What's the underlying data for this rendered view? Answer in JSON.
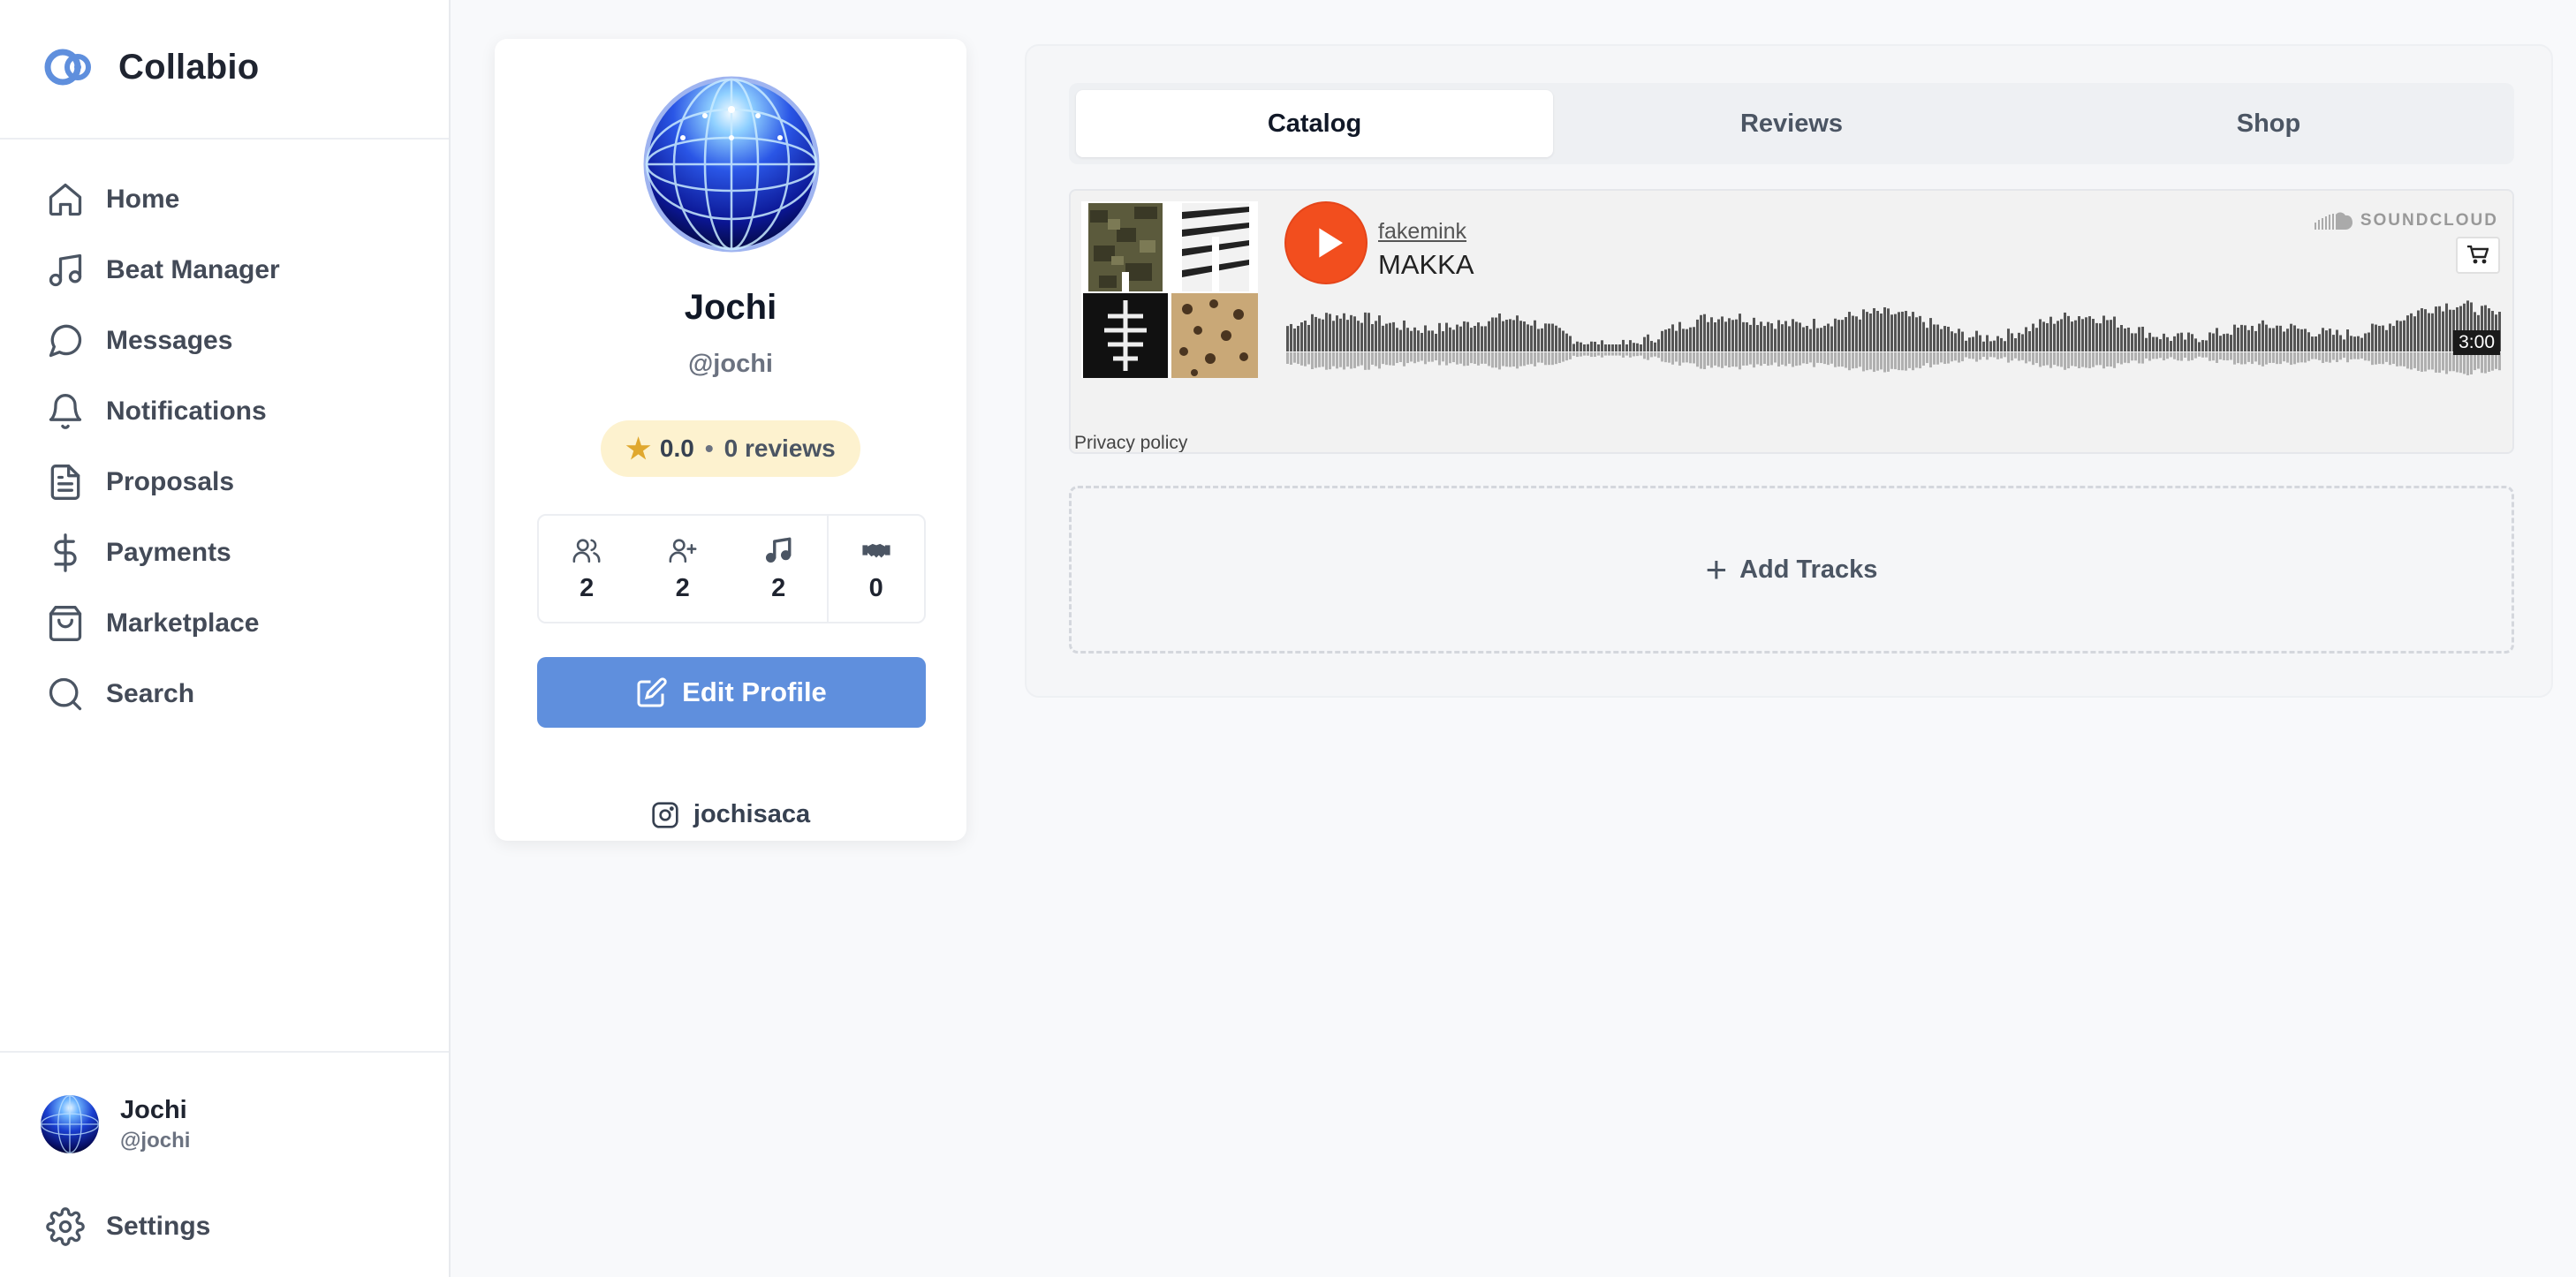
{
  "brand": {
    "name": "Collabio",
    "accent": "#5f8fdd"
  },
  "sidebar": {
    "items": [
      {
        "label": "Home",
        "icon": "home-icon"
      },
      {
        "label": "Beat Manager",
        "icon": "music-note-icon"
      },
      {
        "label": "Messages",
        "icon": "message-bubble-icon"
      },
      {
        "label": "Notifications",
        "icon": "bell-icon"
      },
      {
        "label": "Proposals",
        "icon": "document-icon"
      },
      {
        "label": "Payments",
        "icon": "dollar-icon"
      },
      {
        "label": "Marketplace",
        "icon": "shopping-bag-icon"
      },
      {
        "label": "Search",
        "icon": "search-icon"
      }
    ],
    "user": {
      "name": "Jochi",
      "handle": "@jochi"
    },
    "settings_label": "Settings"
  },
  "profile": {
    "name": "Jochi",
    "handle": "@jochi",
    "rating_value": "0.0",
    "rating_reviews": "0 reviews",
    "rating_separator": "•",
    "stats": [
      {
        "icon": "followers-icon",
        "value": "2"
      },
      {
        "icon": "following-icon",
        "value": "2"
      },
      {
        "icon": "music-note-icon",
        "value": "2"
      },
      {
        "icon": "handshake-icon",
        "value": "0"
      }
    ],
    "edit_label": "Edit Profile",
    "instagram": "jochisaca"
  },
  "tabs": [
    {
      "label": "Catalog",
      "active": true
    },
    {
      "label": "Reviews",
      "active": false
    },
    {
      "label": "Shop",
      "active": false
    }
  ],
  "player": {
    "artist": "fakemink",
    "title": "MAKKA",
    "brand": "SOUNDCLOUD",
    "duration": "3:00",
    "privacy": "Privacy policy",
    "play_color": "#f24e1e"
  },
  "add_tracks": {
    "label": "Add Tracks",
    "icon": "plus-icon"
  }
}
